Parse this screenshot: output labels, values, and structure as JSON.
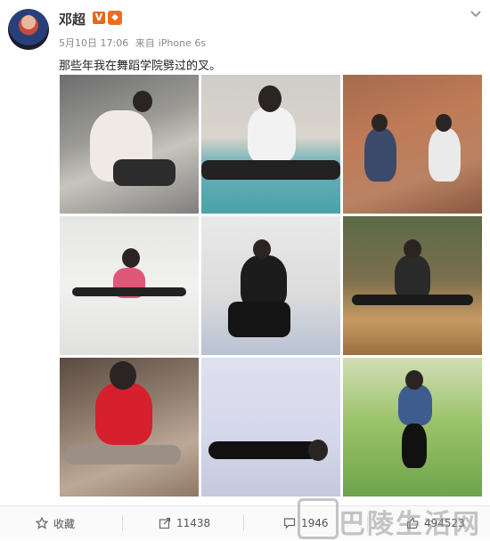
{
  "post": {
    "username": "邓超",
    "verified_mark": "V",
    "date": "5月10日 17:06",
    "source_prefix": "来自",
    "source_device": "iPhone 6s",
    "text": "那些年我在舞蹈学院劈过的叉。"
  },
  "photos": [
    {
      "label": "photo-1"
    },
    {
      "label": "photo-2"
    },
    {
      "label": "photo-3"
    },
    {
      "label": "photo-4"
    },
    {
      "label": "photo-5"
    },
    {
      "label": "photo-6"
    },
    {
      "label": "photo-7"
    },
    {
      "label": "photo-8"
    },
    {
      "label": "photo-9"
    }
  ],
  "actions": {
    "favorite_label": "收藏",
    "repost_count": "11438",
    "comment_count": "1946",
    "like_count": "494523"
  },
  "watermark": {
    "text": "巴陵生活网"
  },
  "colors": {
    "verified": "#e36a1f",
    "text_muted": "#8a8a8a",
    "divider": "#e6e6e6"
  },
  "icons": [
    "chevron-down-icon",
    "star-icon",
    "share-icon",
    "comment-icon",
    "like-icon"
  ]
}
